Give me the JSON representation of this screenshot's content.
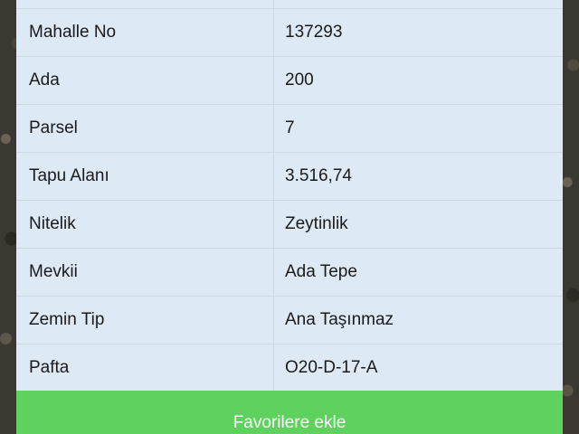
{
  "rows": [
    {
      "label": "",
      "value": ""
    },
    {
      "label": "Mahalle No",
      "value": "137293"
    },
    {
      "label": "Ada",
      "value": "200"
    },
    {
      "label": "Parsel",
      "value": "7"
    },
    {
      "label": "Tapu Alanı",
      "value": "3.516,74"
    },
    {
      "label": "Nitelik",
      "value": "Zeytinlik"
    },
    {
      "label": "Mevkii",
      "value": "Ada Tepe"
    },
    {
      "label": "Zemin Tip",
      "value": "Ana Taşınmaz"
    },
    {
      "label": "Pafta",
      "value": "O20-D-17-A"
    }
  ],
  "favorite_button": {
    "label": "Favorilere ekle",
    "color": "#5fd15f"
  },
  "colors": {
    "cell_bg": "#dde9f4",
    "divider": "#cfd9e3"
  }
}
